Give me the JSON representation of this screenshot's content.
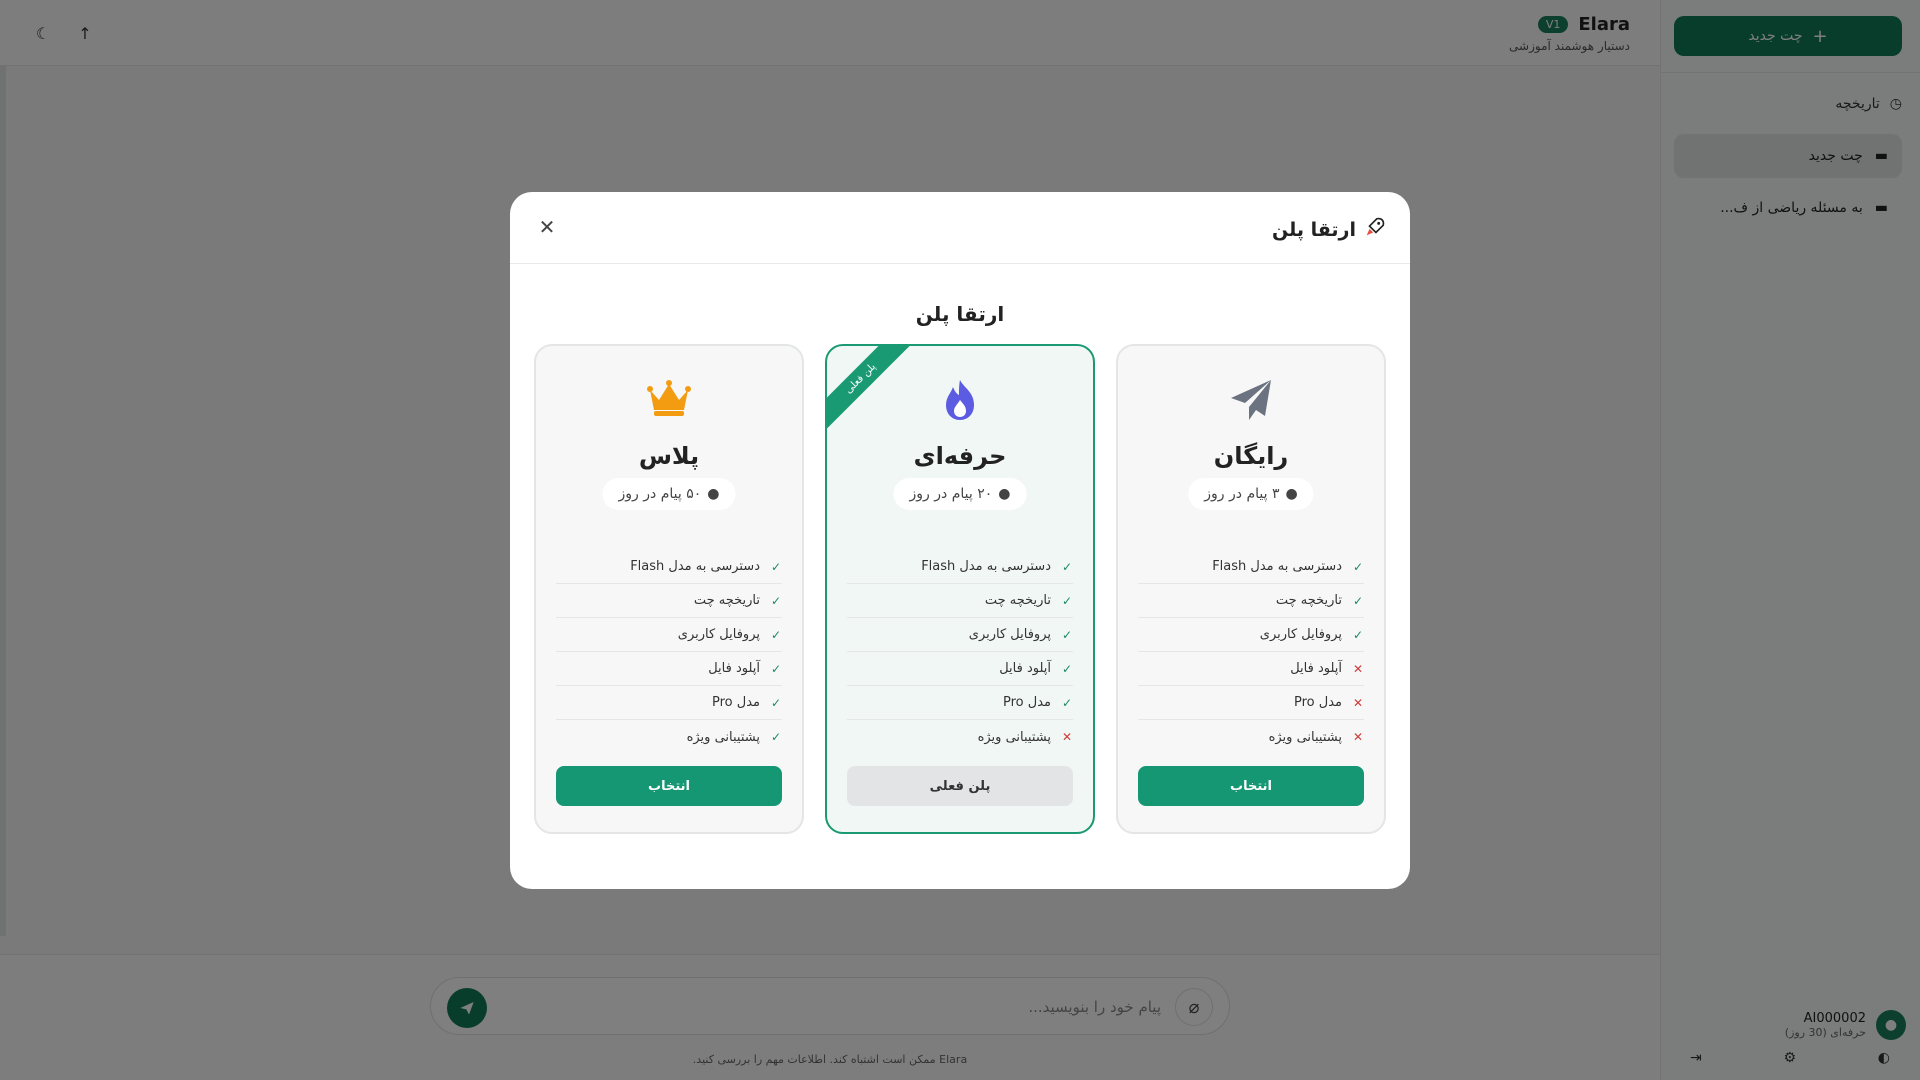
{
  "app": {
    "brand_name": "Elara",
    "brand_version": "V1",
    "brand_subtitle": "دستیار هوشمند آموزشی",
    "new_chat_label": "چت جدید",
    "history_label": "تاریخچه",
    "chats": [
      {
        "label": "چت جدید",
        "active": true
      },
      {
        "label": "به مسئله ریاضی از ف...",
        "active": false
      }
    ],
    "user": {
      "name": "AI000002",
      "plan": "حرفه‌ای (30 روز)"
    },
    "composer_placeholder": "پیام خود را بنویسید...",
    "disclaimer": "Elara ممکن است اشتباه کند. اطلاعات مهم را بررسی کنید."
  },
  "modal": {
    "title": "ارتقا پلن",
    "subtitle": "ارتقا پلن",
    "close_icon": "close-icon",
    "plans": [
      {
        "key": "plus",
        "name": "پلاس",
        "icon": "crown-icon",
        "icon_color": "#f39c12",
        "messages": "۵۰ پیام در روز",
        "current": false,
        "ribbon": "",
        "button_label": "انتخاب",
        "features": [
          {
            "label": "دسترسی به مدل Flash",
            "included": true
          },
          {
            "label": "تاریخچه چت",
            "included": true
          },
          {
            "label": "پروفایل کاربری",
            "included": true
          },
          {
            "label": "آپلود فایل",
            "included": true
          },
          {
            "label": "مدل Pro",
            "included": true
          },
          {
            "label": "پشتیبانی ویژه",
            "included": true
          }
        ]
      },
      {
        "key": "pro",
        "name": "حرفه‌ای",
        "icon": "fire-icon",
        "icon_color": "#5b5ce2",
        "messages": "۲۰ پیام در روز",
        "current": true,
        "ribbon": "پلن فعلی",
        "button_label": "پلن فعلی",
        "features": [
          {
            "label": "دسترسی به مدل Flash",
            "included": true
          },
          {
            "label": "تاریخچه چت",
            "included": true
          },
          {
            "label": "پروفایل کاربری",
            "included": true
          },
          {
            "label": "آپلود فایل",
            "included": true
          },
          {
            "label": "مدل Pro",
            "included": true
          },
          {
            "label": "پشتیبانی ویژه",
            "included": false
          }
        ]
      },
      {
        "key": "free",
        "name": "رایگان",
        "icon": "paper-plane-icon",
        "icon_color": "#6b7280",
        "messages": "۳ پیام در روز",
        "current": false,
        "ribbon": "",
        "button_label": "انتخاب",
        "features": [
          {
            "label": "دسترسی به مدل Flash",
            "included": true
          },
          {
            "label": "تاریخچه چت",
            "included": true
          },
          {
            "label": "پروفایل کاربری",
            "included": true
          },
          {
            "label": "آپلود فایل",
            "included": false
          },
          {
            "label": "مدل Pro",
            "included": false
          },
          {
            "label": "پشتیبانی ویژه",
            "included": false
          }
        ]
      }
    ]
  }
}
